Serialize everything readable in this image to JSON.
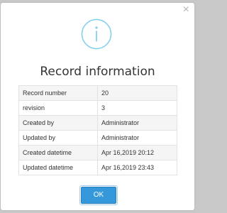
{
  "dialog": {
    "close_icon": "close-icon",
    "icon": "info-icon",
    "title": "Record information",
    "accent_color": "#7fd0ef",
    "button_color": "#3498db",
    "rows": [
      {
        "label": "Record number",
        "value": "20"
      },
      {
        "label": "revision",
        "value": "3"
      },
      {
        "label": "Created by",
        "value": "Administrator"
      },
      {
        "label": "Updated by",
        "value": "Administrator"
      },
      {
        "label": "Created datetime",
        "value": "Apr 16,2019 20:12"
      },
      {
        "label": "Updated datetime",
        "value": "Apr 16,2019 23:43"
      }
    ],
    "ok_label": "OK"
  }
}
